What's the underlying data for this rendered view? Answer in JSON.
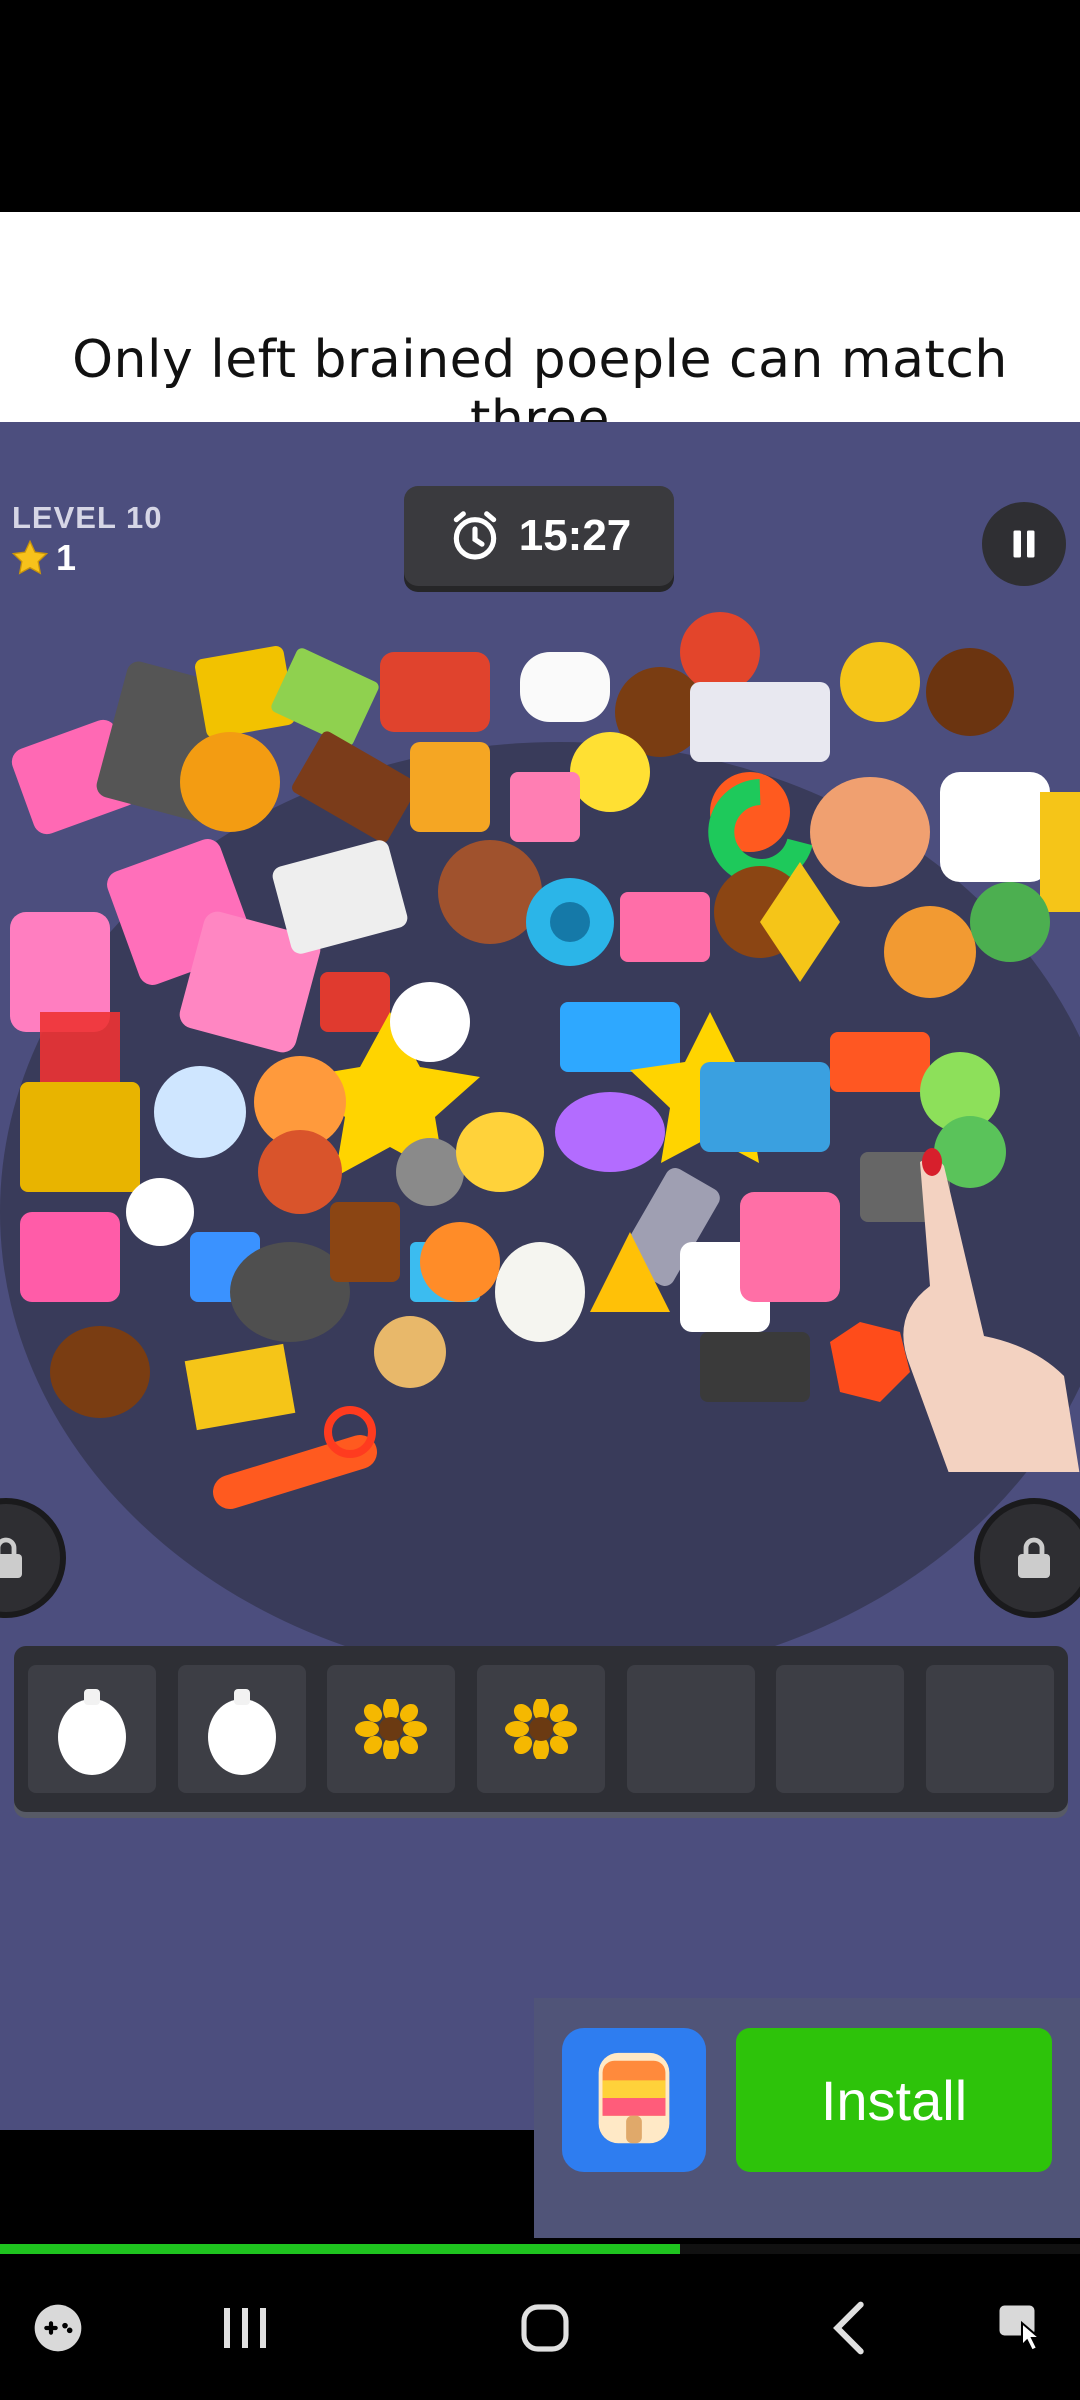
{
  "caption": "Only left brained poeple can match three",
  "game": {
    "level_label": "LEVEL 10",
    "stars": "1",
    "timer": "15:27"
  },
  "tray": {
    "slots": [
      "egg",
      "egg",
      "sunflower",
      "sunflower",
      "",
      "",
      ""
    ]
  },
  "ad": {
    "install_label": "Install",
    "app_icon": "popsicle-icon"
  },
  "video_progress": 0.63,
  "colors": {
    "game_bg": "#4c4e7e",
    "install_green": "#2dc30a",
    "progress_green": "#1fc31f"
  }
}
